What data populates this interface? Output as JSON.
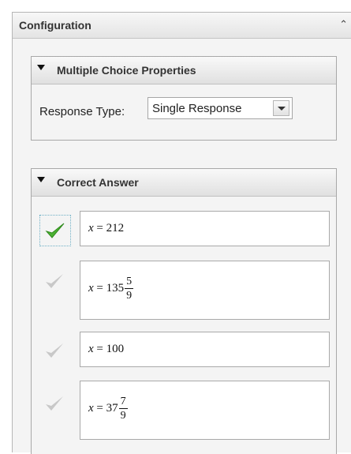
{
  "panel": {
    "title": "Configuration",
    "collapse_icon": "double-chevron-up-icon"
  },
  "mc_properties": {
    "title": "Multiple Choice Properties",
    "response_type_label": "Response Type:",
    "response_type_value": "Single Response"
  },
  "correct_answer": {
    "title": "Correct Answer",
    "answers": [
      {
        "var": "x",
        "eq": " = ",
        "whole": "212",
        "selected": true
      },
      {
        "var": "x",
        "eq": " = ",
        "whole": "135",
        "num": "5",
        "den": "9",
        "selected": false
      },
      {
        "var": "x",
        "eq": " = ",
        "whole": "100",
        "selected": false
      },
      {
        "var": "x",
        "eq": " = ",
        "whole": "37",
        "num": "7",
        "den": "9",
        "selected": false
      }
    ]
  },
  "colors": {
    "check_selected": "#4cb233",
    "check_unselected": "#c8c8c8"
  }
}
